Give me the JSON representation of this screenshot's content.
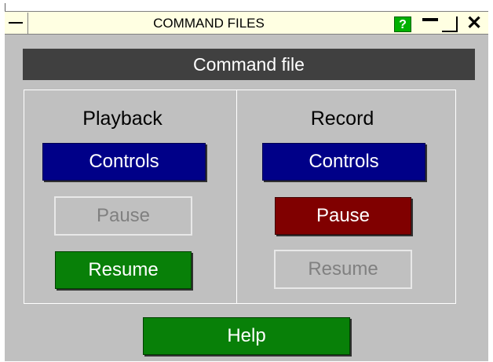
{
  "window": {
    "title": "COMMAND FILES",
    "help_icon_label": "?"
  },
  "header": {
    "title": "Command file"
  },
  "playback": {
    "title": "Playback",
    "controls_label": "Controls",
    "pause_label": "Pause",
    "resume_label": "Resume",
    "pause_enabled": false,
    "resume_enabled": true
  },
  "record": {
    "title": "Record",
    "controls_label": "Controls",
    "pause_label": "Pause",
    "resume_label": "Resume",
    "pause_enabled": true,
    "resume_enabled": false
  },
  "footer": {
    "help_label": "Help"
  },
  "colors": {
    "titlebar_bg": "#ffffe2",
    "window_bg": "#c0c0c0",
    "header_bg": "#404040",
    "button_blue": "#000088",
    "button_green": "#088008",
    "button_red": "#800000",
    "disabled_text": "#808080"
  },
  "icons": {
    "system_menu": "system-menu-icon",
    "help": "help-icon",
    "minimize": "minimize-icon",
    "maximize": "maximize-icon",
    "close": "close-icon"
  }
}
